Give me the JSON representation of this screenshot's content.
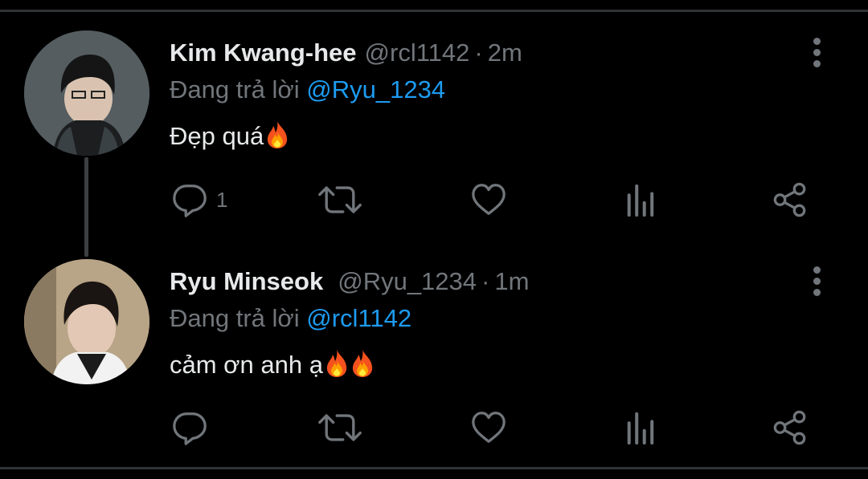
{
  "colors": {
    "background": "#000000",
    "primary_text": "#e7e9ea",
    "secondary_text": "#71767b",
    "link": "#1d9bf0",
    "divider": "#2f3336"
  },
  "tweets": [
    {
      "display_name": "Kim Kwang-hee",
      "handle": "@rcl1142",
      "separator": "·",
      "time": "2m",
      "reply_prefix": "Đang trả lời",
      "reply_to": "@Ryu_1234",
      "text": "Đẹp quá",
      "emojis": [
        "fire-emoji"
      ],
      "reply_count": "1",
      "icons": [
        "reply-icon",
        "retweet-icon",
        "like-icon",
        "analytics-icon",
        "share-icon",
        "more-options-icon"
      ]
    },
    {
      "display_name": "Ryu Minseok",
      "handle": "@Ryu_1234",
      "separator": "·",
      "time": "1m",
      "reply_prefix": "Đang trả lời",
      "reply_to": "@rcl1142",
      "text": "cảm ơn anh ạ",
      "emojis": [
        "fire-emoji",
        "fire-emoji"
      ],
      "reply_count": "",
      "icons": [
        "reply-icon",
        "retweet-icon",
        "like-icon",
        "analytics-icon",
        "share-icon",
        "more-options-icon"
      ]
    }
  ]
}
